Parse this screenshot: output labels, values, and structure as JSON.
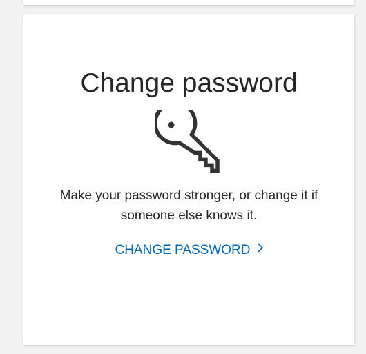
{
  "card": {
    "title": "Change password",
    "icon": "key-icon",
    "description": "Make your password stronger, or change it if someone else knows it.",
    "link_label": "CHANGE PASSWORD",
    "link_icon": "chevron-right-icon"
  },
  "colors": {
    "link": "#0067b8",
    "text": "#262626",
    "background": "#f2f2f2",
    "card": "#ffffff"
  }
}
